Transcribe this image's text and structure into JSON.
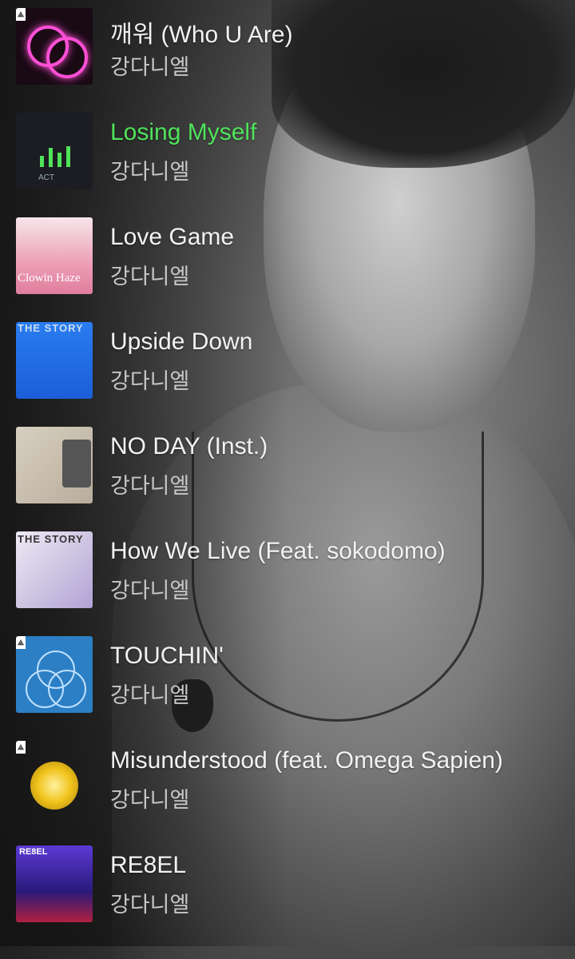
{
  "colors": {
    "active_title": "#4fe35a",
    "title": "#f2f2f2",
    "artist": "#c6c6c6"
  },
  "cover_labels": {
    "losing_myself": "ACT",
    "love_game": "Clowin Haze",
    "upside_down": "THE STORY",
    "how_we_live": "THE STORY",
    "rebel": "RE8EL"
  },
  "playlist": [
    {
      "title": "깨워 (Who U Are)",
      "artist": "강다니엘",
      "active": false,
      "cover": "pink-rings-cover"
    },
    {
      "title": "Losing Myself",
      "artist": "강다니엘",
      "active": true,
      "cover": "now-playing-cover"
    },
    {
      "title": "Love Game",
      "artist": "강다니엘",
      "active": false,
      "cover": "pink-gradient-cover"
    },
    {
      "title": "Upside Down",
      "artist": "강다니엘",
      "active": false,
      "cover": "blue-story-cover"
    },
    {
      "title": "NO DAY (Inst.)",
      "artist": "강다니엘",
      "active": false,
      "cover": "desk-photo-cover"
    },
    {
      "title": "How We Live (Feat. sokodomo)",
      "artist": "강다니엘",
      "active": false,
      "cover": "purple-story-cover"
    },
    {
      "title": "TOUCHIN'",
      "artist": "강다니엘",
      "active": false,
      "cover": "blue-circles-cover"
    },
    {
      "title": "Misunderstood (feat. Omega Sapien)",
      "artist": "강다니엘",
      "active": false,
      "cover": "gold-disc-cover"
    },
    {
      "title": "RE8EL",
      "artist": "강다니엘",
      "active": false,
      "cover": "rebel-cover"
    }
  ]
}
